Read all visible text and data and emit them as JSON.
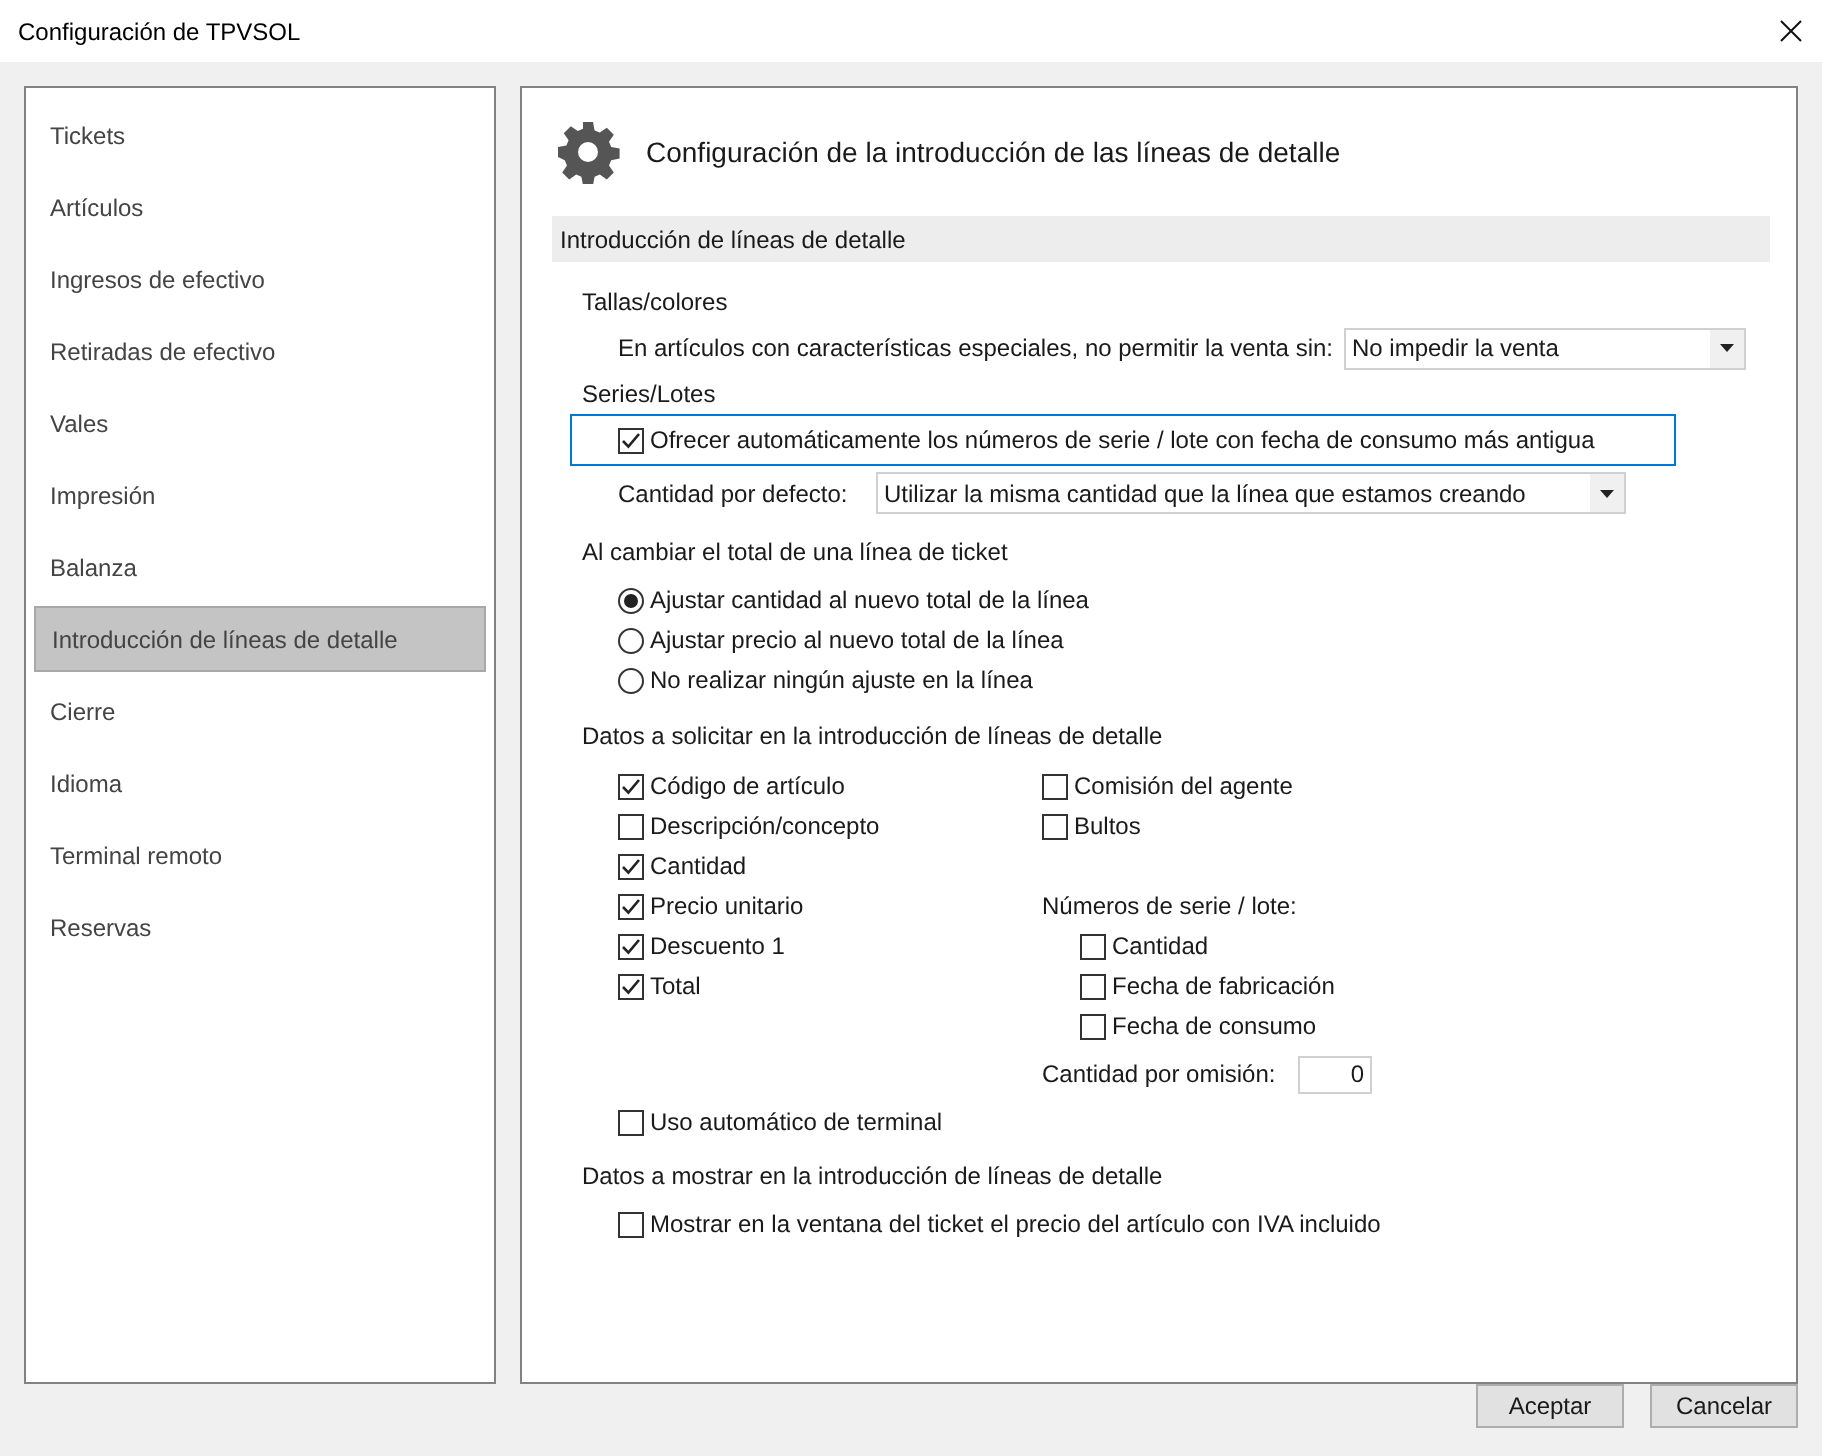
{
  "window": {
    "title": "Configuración de TPVSOL"
  },
  "sidebar": {
    "items": [
      {
        "label": "Tickets",
        "selected": false
      },
      {
        "label": "Artículos",
        "selected": false
      },
      {
        "label": "Ingresos de efectivo",
        "selected": false
      },
      {
        "label": "Retiradas de efectivo",
        "selected": false
      },
      {
        "label": "Vales",
        "selected": false
      },
      {
        "label": "Impresión",
        "selected": false
      },
      {
        "label": "Balanza",
        "selected": false
      },
      {
        "label": "Introducción de líneas de detalle",
        "selected": true
      },
      {
        "label": "Cierre",
        "selected": false
      },
      {
        "label": "Idioma",
        "selected": false
      },
      {
        "label": "Terminal remoto",
        "selected": false
      },
      {
        "label": "Reservas",
        "selected": false
      }
    ]
  },
  "content": {
    "title": "Configuración de la introducción de las líneas de detalle",
    "section_title": "Introducción de líneas de detalle",
    "tallas": {
      "heading": "Tallas/colores",
      "label": "En artículos con características especiales, no permitir la venta sin:",
      "value": "No impedir la venta"
    },
    "series": {
      "heading": "Series/Lotes",
      "auto_option": {
        "label": "Ofrecer automáticamente los números de serie / lote con fecha de consumo más antigua",
        "checked": true,
        "focused": true
      },
      "default_qty": {
        "label": "Cantidad por defecto:",
        "value": "Utilizar la misma cantidad que la línea que estamos creando"
      }
    },
    "total_change": {
      "heading": "Al cambiar el total de una línea de ticket",
      "options": [
        {
          "label": "Ajustar cantidad al nuevo total de la línea",
          "selected": true
        },
        {
          "label": "Ajustar precio al nuevo total de la línea",
          "selected": false
        },
        {
          "label": "No realizar ningún ajuste en la línea",
          "selected": false
        }
      ]
    },
    "request": {
      "heading": "Datos a solicitar en la introducción de líneas de detalle",
      "left": [
        {
          "label": "Código de artículo",
          "checked": true
        },
        {
          "label": "Descripción/concepto",
          "checked": false
        },
        {
          "label": "Cantidad",
          "checked": true
        },
        {
          "label": "Precio unitario",
          "checked": true
        },
        {
          "label": "Descuento 1",
          "checked": true
        },
        {
          "label": "Total",
          "checked": true
        }
      ],
      "right": [
        {
          "label": "Comisión del agente",
          "checked": false
        },
        {
          "label": "Bultos",
          "checked": false
        }
      ],
      "serial": {
        "heading": "Números de serie / lote:",
        "options": [
          {
            "label": "Cantidad",
            "checked": false
          },
          {
            "label": "Fecha de fabricación",
            "checked": false
          },
          {
            "label": "Fecha de consumo",
            "checked": false
          }
        ]
      },
      "default_qty": {
        "label": "Cantidad por omisión:",
        "value": "0"
      },
      "auto_terminal": {
        "label": "Uso automático de terminal",
        "checked": false
      }
    },
    "display": {
      "heading": "Datos a mostrar en la introducción de líneas de detalle",
      "options": [
        {
          "label": "Mostrar en la ventana del ticket el precio del artículo con IVA incluido",
          "checked": false
        }
      ]
    }
  },
  "buttons": [
    {
      "label": "Aceptar"
    },
    {
      "label": "Cancelar"
    }
  ]
}
